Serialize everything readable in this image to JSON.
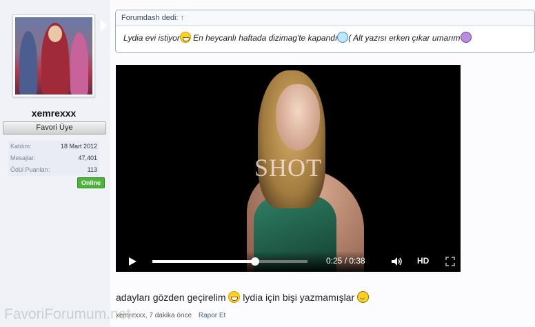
{
  "user": {
    "username": "xemrexxx",
    "title": "Favori Üye",
    "stats": [
      {
        "label": "Katılım:",
        "value": "18 Mart 2012"
      },
      {
        "label": "Mesajlar:",
        "value": "47,401"
      },
      {
        "label": "Ödül Puanları:",
        "value": "113"
      }
    ],
    "online_badge": "Online"
  },
  "quote": {
    "header": "Forumdash dedi:",
    "header_arrow": "↑",
    "segments": [
      "Lydia evi istiyor",
      " En heycanlı haftada dizimag'te kapandı",
      "( Alt yazısı erken çıkar umarım"
    ]
  },
  "video": {
    "overlay_text": "SHOT",
    "time": "0:25 / 0:38",
    "progress": 0.66,
    "hd_label": "HD"
  },
  "post": {
    "text_part1": "adayları gözden geçirelim ",
    "text_part2": " lydia için bişi yazmamışlar ",
    "author": "xemrexxx",
    "time": "7 dakika önce",
    "report_link": "Rapor Et"
  },
  "watermark": "FavoriForumum.net",
  "colors": {
    "online": "#4db53a",
    "quote_border": "#9aaecb",
    "link": "#3e5f9a"
  }
}
